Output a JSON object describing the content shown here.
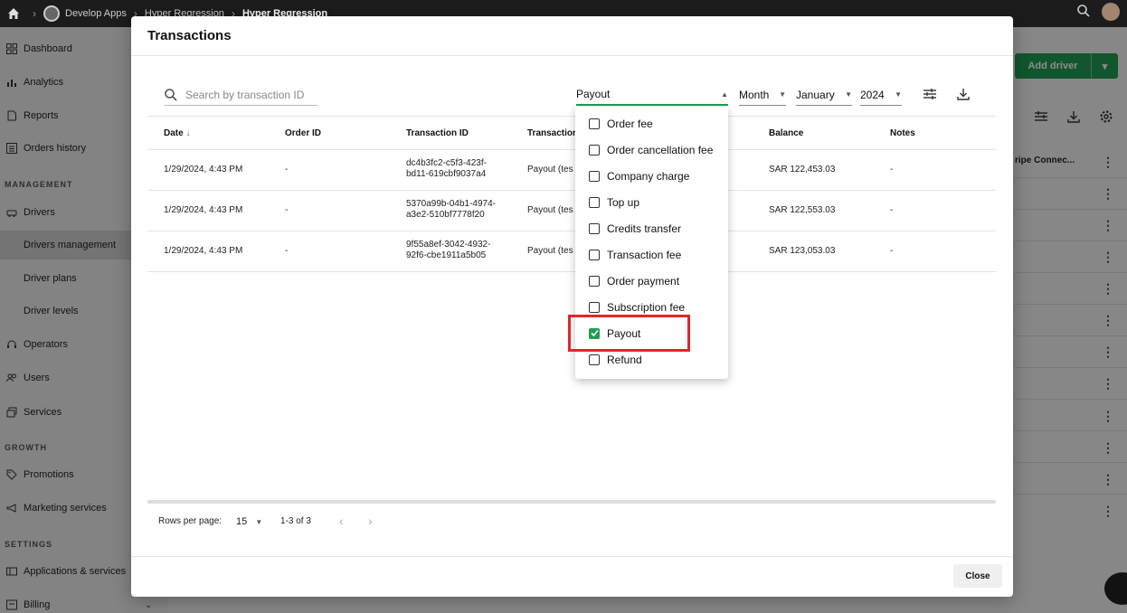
{
  "topbar": {
    "crumbs": [
      "Develop Apps",
      "Hyper Regression",
      "Hyper Regression"
    ]
  },
  "sidebar": {
    "items": [
      {
        "label": "Dashboard",
        "icon": "grid-icon"
      },
      {
        "label": "Analytics",
        "icon": "bar-chart-icon"
      },
      {
        "label": "Reports",
        "icon": "document-icon"
      },
      {
        "label": "Orders history",
        "icon": "list-icon"
      },
      {
        "label": "Drivers",
        "icon": "car-icon"
      },
      {
        "label": "Drivers management"
      },
      {
        "label": "Driver plans"
      },
      {
        "label": "Driver levels"
      },
      {
        "label": "Operators",
        "icon": "headset-icon"
      },
      {
        "label": "Users",
        "icon": "users-icon"
      },
      {
        "label": "Services",
        "icon": "services-icon"
      },
      {
        "label": "Promotions",
        "icon": "tag-icon"
      },
      {
        "label": "Marketing services",
        "icon": "megaphone-icon"
      },
      {
        "label": "Applications & services",
        "icon": "apps-icon"
      },
      {
        "label": "Billing",
        "icon": "billing-icon"
      }
    ],
    "sections": [
      "MANAGEMENT",
      "GROWTH",
      "SETTINGS"
    ]
  },
  "background": {
    "add_driver": "Add driver",
    "first_row_cell": "ripe Connec..."
  },
  "modal": {
    "title": "Transactions",
    "search_placeholder": "Search by transaction ID",
    "type_filter": "Payout",
    "period": "Month",
    "month": "January",
    "year": "2024",
    "columns": [
      "Date",
      "Order ID",
      "Transaction ID",
      "Transaction",
      "Balance",
      "Notes"
    ],
    "rows": [
      {
        "date": "1/29/2024, 4:43 PM",
        "order_id": "-",
        "txn_id_1": "dc4b3fc2-c5f3-423f-",
        "txn_id_2": "bd11-619cbf9037a4",
        "type": "Payout (tes",
        "balance": "SAR 122,453.03",
        "notes": "-"
      },
      {
        "date": "1/29/2024, 4:43 PM",
        "order_id": "-",
        "txn_id_1": "5370a99b-04b1-4974-",
        "txn_id_2": "a3e2-510bf7778f20",
        "type": "Payout (tes",
        "balance": "SAR 122,553.03",
        "notes": "-"
      },
      {
        "date": "1/29/2024, 4:43 PM",
        "order_id": "-",
        "txn_id_1": "9f55a8ef-3042-4932-",
        "txn_id_2": "92f6-cbe1911a5b05",
        "type": "Payout (tes",
        "balance": "SAR 123,053.03",
        "notes": "-"
      }
    ],
    "rows_per_page_label": "Rows per page:",
    "rows_per_page": "15",
    "range": "1-3 of 3",
    "close": "Close"
  },
  "dropdown": {
    "options": [
      {
        "label": "Order fee",
        "checked": false
      },
      {
        "label": "Order cancellation fee",
        "checked": false
      },
      {
        "label": "Company charge",
        "checked": false
      },
      {
        "label": "Top up",
        "checked": false
      },
      {
        "label": "Credits transfer",
        "checked": false
      },
      {
        "label": "Transaction fee",
        "checked": false
      },
      {
        "label": "Order payment",
        "checked": false
      },
      {
        "label": "Subscription fee",
        "checked": false
      },
      {
        "label": "Payout",
        "checked": true
      },
      {
        "label": "Refund",
        "checked": false
      }
    ]
  },
  "colors": {
    "accent": "#1f9d52",
    "highlight": "#e0262c"
  }
}
